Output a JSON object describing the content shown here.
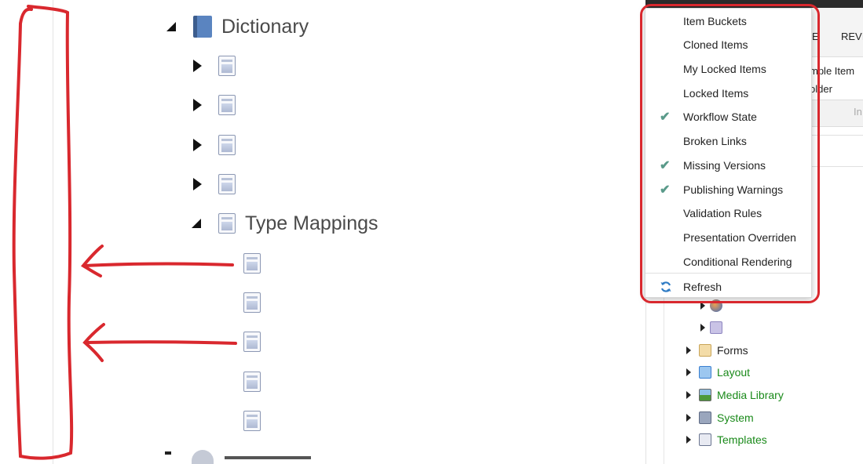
{
  "tree": {
    "dictionary_label": "Dictionary",
    "type_mappings_label": "Type Mappings"
  },
  "ribbon": {
    "tab_partial_e": "E",
    "tab_review": "REVI"
  },
  "header": {
    "sample_item": "mple Item",
    "folder": "older",
    "band_text": "In"
  },
  "content_tree": {
    "items": [
      {
        "label": "Forms",
        "color": "#222222"
      },
      {
        "label": "Layout",
        "color": "#1a8a1a"
      },
      {
        "label": "Media Library",
        "color": "#1a8a1a"
      },
      {
        "label": "System",
        "color": "#1a8a1a"
      },
      {
        "label": "Templates",
        "color": "#1a8a1a"
      }
    ]
  },
  "context_menu": {
    "items": [
      {
        "label": "Item Buckets",
        "checked": false
      },
      {
        "label": "Cloned Items",
        "checked": false
      },
      {
        "label": "My Locked Items",
        "checked": false
      },
      {
        "label": "Locked Items",
        "checked": false
      },
      {
        "label": "Workflow State",
        "checked": true
      },
      {
        "label": "Broken Links",
        "checked": false
      },
      {
        "label": "Missing Versions",
        "checked": true
      },
      {
        "label": "Publishing Warnings",
        "checked": true
      },
      {
        "label": "Validation Rules",
        "checked": false
      },
      {
        "label": "Presentation Overriden",
        "checked": false
      },
      {
        "label": "Conditional Rendering",
        "checked": false
      }
    ],
    "refresh_label": "Refresh",
    "check_glyph": "✔"
  },
  "colors": {
    "annotation_red": "#d9282e",
    "check_teal": "#5a9a8a",
    "link_green": "#1a8a1a"
  }
}
